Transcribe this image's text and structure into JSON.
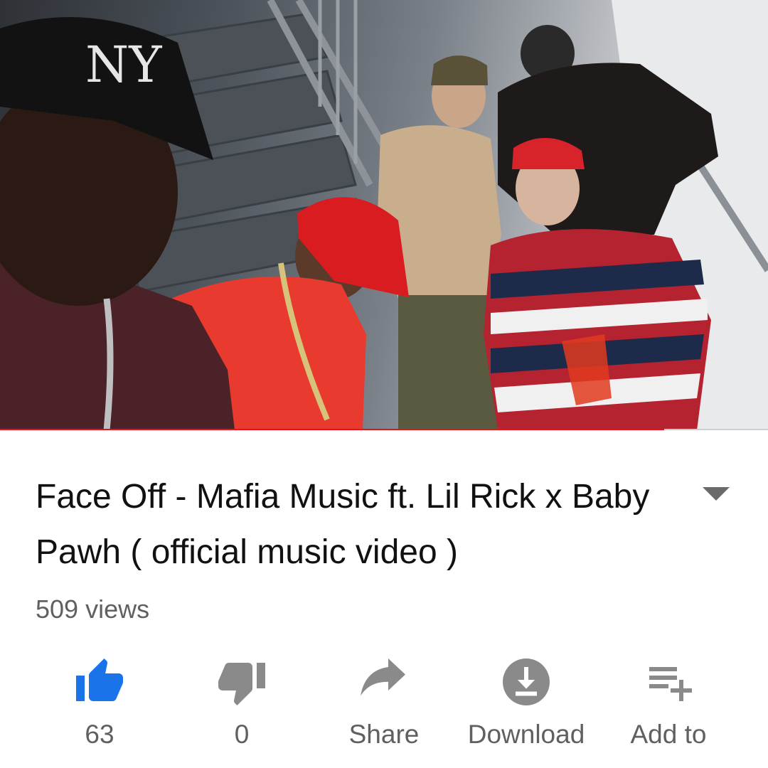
{
  "video": {
    "watched_fraction": 0.865,
    "colors": {
      "progress": "#e8121a",
      "track": "#cfcfcf"
    }
  },
  "info": {
    "title": "Face Off - Mafia Music ft. Lil Rick x Baby Pawh ( official music video )",
    "views": "509 views",
    "expand_icon": "chevron-down-icon"
  },
  "actions": [
    {
      "icon": "thumbs-up-icon",
      "label": "63",
      "active": true,
      "color": "#1a73e8"
    },
    {
      "icon": "thumbs-down-icon",
      "label": "0",
      "active": false,
      "color": "#8a8a8a"
    },
    {
      "icon": "share-icon",
      "label": "Share",
      "active": false,
      "color": "#8a8a8a"
    },
    {
      "icon": "download-icon",
      "label": "Download",
      "active": false,
      "color": "#8a8a8a"
    },
    {
      "icon": "playlist-add-icon",
      "label": "Add to",
      "active": false,
      "color": "#8a8a8a"
    }
  ]
}
